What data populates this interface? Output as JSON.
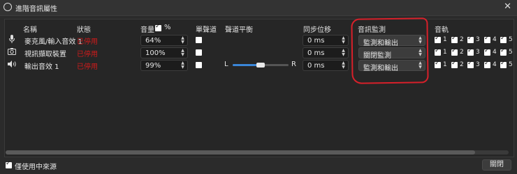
{
  "window": {
    "title": "進階音訊屬性",
    "close_glyph": "✕"
  },
  "headers": {
    "name": "名稱",
    "status": "狀態",
    "volume": "音量",
    "percent": "%",
    "mono": "單聲道",
    "balance": "聲道平衡",
    "sync_offset": "同步位移",
    "monitoring": "音訊監測",
    "tracks": "音軌"
  },
  "sources": [
    {
      "icon": "microphone-icon",
      "name": "麥克風/輸入音效 1",
      "status": "已停用",
      "volume": "64%",
      "mono": false,
      "balance": null,
      "sync_offset": "0 ms",
      "monitoring": "監測和輸出",
      "tracks": [
        "1",
        "2",
        "3",
        "4",
        "5"
      ]
    },
    {
      "icon": "camera-icon",
      "name": "視訊擷取裝置",
      "status": "已停用",
      "volume": "100%",
      "mono": false,
      "balance": null,
      "sync_offset": "0 ms",
      "monitoring": "關閉監測",
      "tracks": [
        "1",
        "2",
        "3",
        "4",
        "5"
      ]
    },
    {
      "icon": "speaker-icon",
      "name": "輸出音效 1",
      "status": "已停用",
      "volume": "99%",
      "mono": false,
      "balance": {
        "left_label": "L",
        "right_label": "R",
        "value": 0.5
      },
      "sync_offset": "0 ms",
      "monitoring": "監測和輸出",
      "tracks": [
        "1",
        "2",
        "3",
        "4",
        "5"
      ]
    }
  ],
  "footer": {
    "active_only_label": "僅使用中來源",
    "close_button": "關閉"
  },
  "colors": {
    "status_disabled": "#d11b1b",
    "slider_fill": "#3a86d8",
    "annotation": "#d8202a"
  }
}
